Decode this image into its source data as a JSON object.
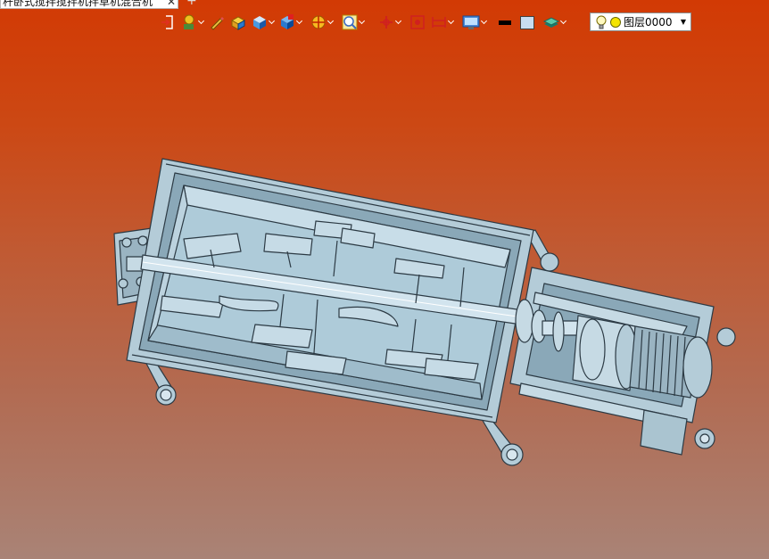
{
  "tab": {
    "title": "杆卧式搅拌搅拌机拌草机混合机",
    "close_glyph": "✕",
    "new_tab_glyph": "+"
  },
  "toolbar": {
    "icons": [
      "exit-sketch-icon",
      "render-style-icon",
      "pencil-icon",
      "box-edges-icon",
      "shaded-cube-icon",
      "section-view-icon",
      "snap-mode-icon",
      "zoom-fit-icon",
      "orient-icon",
      "measure-icon",
      "dimension-icon",
      "display-settings-icon",
      "black-color-swatch",
      "light-color-swatch",
      "layers-icon"
    ],
    "swatch_colors": {
      "black": "#000000",
      "light": "#c8dcf0"
    }
  },
  "layer_select": {
    "value": "图层0000",
    "bulb_icon": "bulb-icon",
    "status_color": "#f4e400"
  },
  "viewport": {
    "background_top": "#d23a04",
    "background_bottom": "#a98376",
    "model_color": "#b4ccd8"
  }
}
